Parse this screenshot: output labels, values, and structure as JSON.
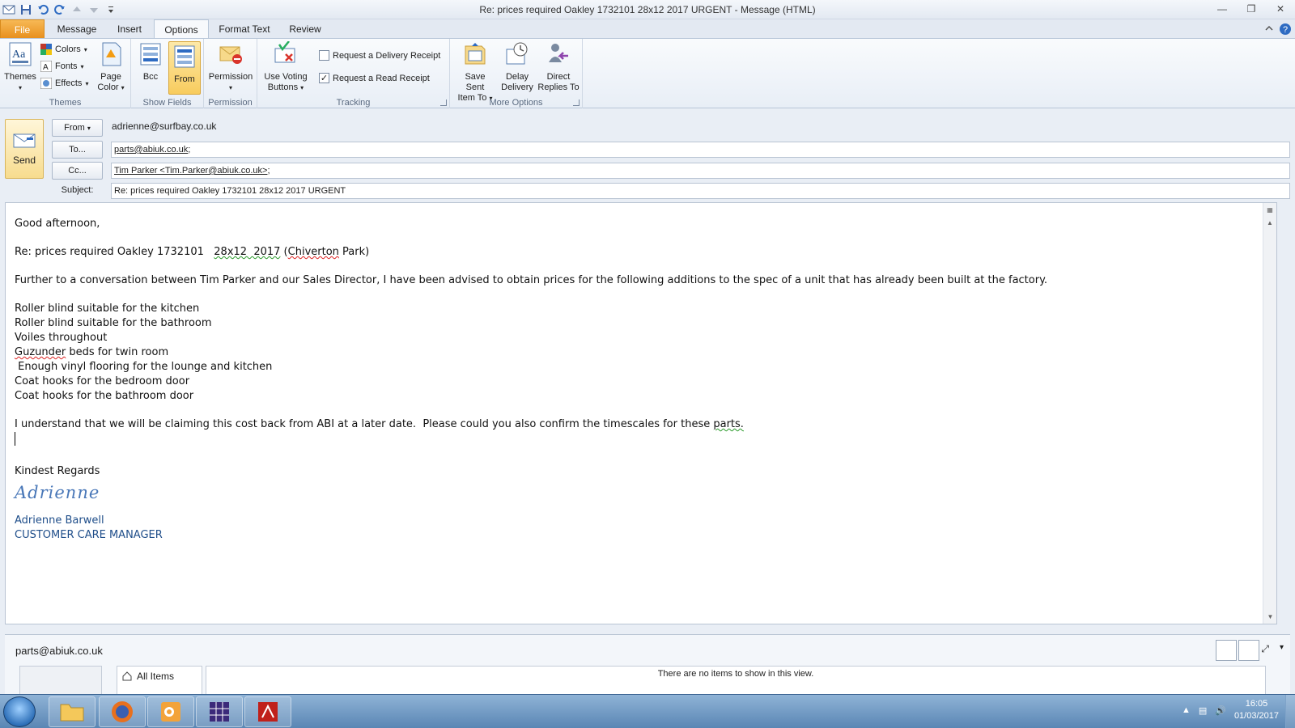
{
  "window": {
    "title": "Re: prices required Oakley 1732101   28x12  2017 URGENT  -  Message (HTML)"
  },
  "tabs": [
    {
      "label": "File"
    },
    {
      "label": "Message"
    },
    {
      "label": "Insert"
    },
    {
      "label": "Options"
    },
    {
      "label": "Format Text"
    },
    {
      "label": "Review"
    }
  ],
  "ribbon": {
    "themes_group": {
      "label": "Themes",
      "themes_button": "Themes",
      "colors": "Colors",
      "fonts": "Fonts",
      "effects": "Effects",
      "page_color_line1": "Page",
      "page_color_line2": "Color"
    },
    "show_fields_group": {
      "label": "Show Fields",
      "bcc": "Bcc",
      "from": "From"
    },
    "permission_group": {
      "label": "Permission",
      "permission": "Permission"
    },
    "tracking_group": {
      "label": "Tracking",
      "voting_line1": "Use Voting",
      "voting_line2": "Buttons",
      "delivery_receipt": "Request a Delivery Receipt",
      "delivery_receipt_checked": false,
      "read_receipt": "Request a Read Receipt",
      "read_receipt_checked": true
    },
    "more_options_group": {
      "label": "More Options",
      "save_sent_line1": "Save Sent",
      "save_sent_line2": "Item To",
      "delay_line1": "Delay",
      "delay_line2": "Delivery",
      "direct_line1": "Direct",
      "direct_line2": "Replies To"
    }
  },
  "header": {
    "send": "Send",
    "from_button": "From",
    "from_value": "adrienne@surfbay.co.uk",
    "to_button": "To...",
    "to_value": "parts@abiuk.co.uk",
    "to_suffix": ";",
    "cc_button": "Cc...",
    "cc_value": "Tim Parker <Tim.Parker@abiuk.co.uk>",
    "cc_suffix": ";",
    "subject_label": "Subject:",
    "subject_value": "Re: prices required Oakley 1732101   28x12  2017 URGENT"
  },
  "body": {
    "greeting": "Good afternoon,",
    "re_prefix": "Re: prices required Oakley 1732101   ",
    "re_underlined": "28x12  2017",
    "re_space": " (",
    "re_place": "Chiverton",
    "re_suffix": " Park)",
    "paragraph1": "Further to a conversation between Tim Parker and our Sales Director, I have been advised to obtain prices for the following additions to the spec of a unit that has already been built at the factory.",
    "item1": "Roller blind suitable for the kitchen",
    "item2": "Roller blind suitable for the bathroom",
    "item3": "Voiles throughout",
    "item4_word": "Guzunder",
    "item4_rest": " beds for twin room",
    "item5": " Enough vinyl flooring for the lounge and kitchen",
    "item6": "Coat hooks for the bedroom door",
    "item7": "Coat hooks for the bathroom door",
    "paragraph2_main": "I understand that we will be claiming this cost back from ABI at a later date.  Please could you also confirm the timescales for these ",
    "paragraph2_end": "parts.",
    "closing": "Kindest Regards",
    "signature_script": "Adrienne",
    "sig_name": "Adrienne Barwell",
    "sig_title": "CUSTOMER CARE MANAGER"
  },
  "people_pane": {
    "email": "parts@abiuk.co.uk",
    "all_items": "All Items",
    "empty_message": "There are no items to show in this view."
  },
  "taskbar": {
    "time": "16:05",
    "date": "01/03/2017"
  },
  "colors": {
    "file_tab": "#e8901e",
    "active_button": "#f8cc5e",
    "signature": "#4a78b8",
    "signature_name": "#1f4e8a"
  }
}
